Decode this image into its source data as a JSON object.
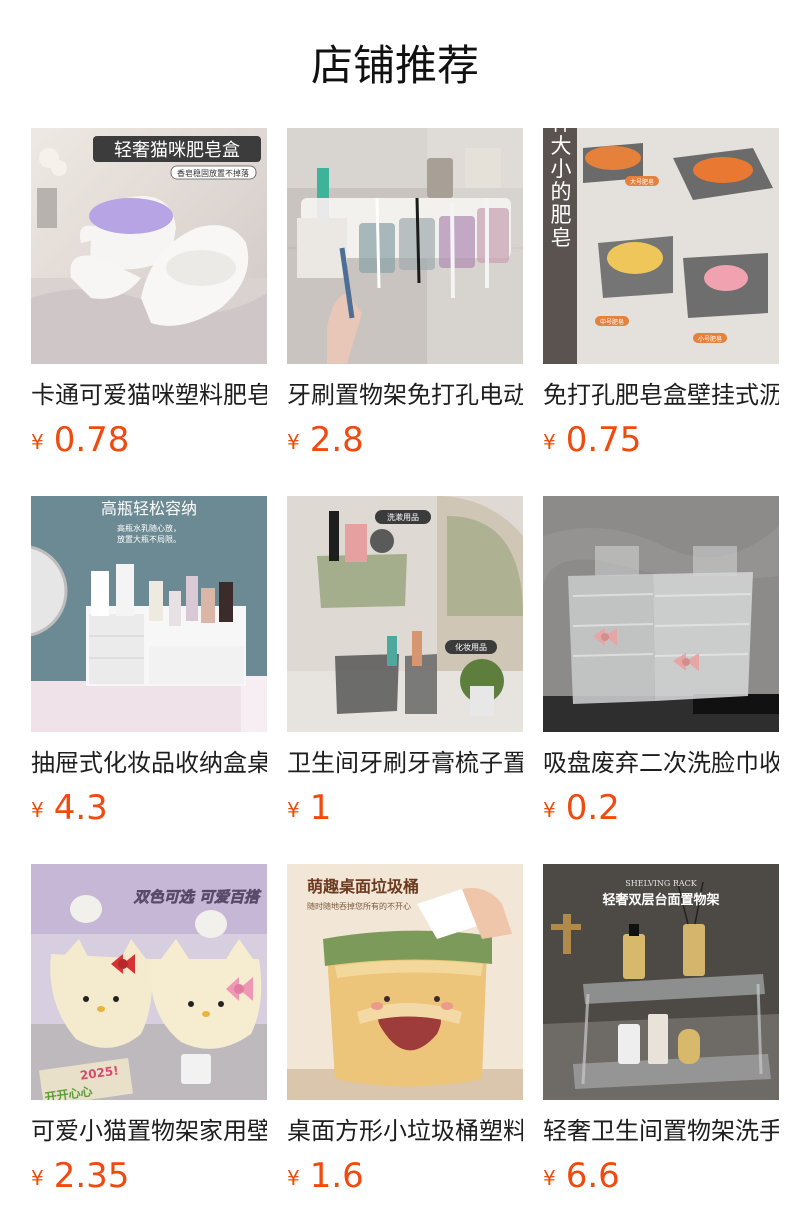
{
  "header": {
    "title": "店铺推荐"
  },
  "currency_symbol": "¥",
  "products": [
    {
      "name": "卡通可爱猫咪塑料肥皂盒",
      "price": "0.78",
      "banner": "轻奢猫咪肥皂盒",
      "banner_sub": "香皂稳固放置不掉落"
    },
    {
      "name": "牙刷置物架免打孔电动",
      "price": "2.8",
      "banner": "",
      "banner_sub": ""
    },
    {
      "name": "免打孔肥皂盒壁挂式沥水",
      "price": "0.75",
      "banner": "适用各种大小的肥皂",
      "banner_sub": "大号肥皂",
      "banner_sub2": "中号肥皂",
      "banner_sub3": "小号肥皂"
    },
    {
      "name": "抽屉式化妆品收纳盒桌面",
      "price": "4.3",
      "banner": "高瓶轻松容纳",
      "banner_sub": "高瓶水乳随心放，",
      "banner_sub2": "放置大瓶不局限。"
    },
    {
      "name": "卫生间牙刷牙膏梳子置物",
      "price": "1",
      "banner": "洗漱用品",
      "banner_sub": "化妆用品"
    },
    {
      "name": "吸盘废弃二次洗脸巾收纳",
      "price": "0.2",
      "banner": "",
      "banner_sub": ""
    },
    {
      "name": "可爱小猫置物架家用壁挂",
      "price": "2.35",
      "banner": "双色可选 可爱百搭",
      "banner_sub": "2025!",
      "banner_sub2": "开开心心"
    },
    {
      "name": "桌面方形小垃圾桶塑料",
      "price": "1.6",
      "banner": "萌趣桌面垃圾桶",
      "banner_sub": "随时随地吞掉您所有的不开心"
    },
    {
      "name": "轻奢卫生间置物架洗手台",
      "price": "6.6",
      "banner": "轻奢双层台面置物架",
      "banner_sub": "SHELVING RACK"
    }
  ]
}
